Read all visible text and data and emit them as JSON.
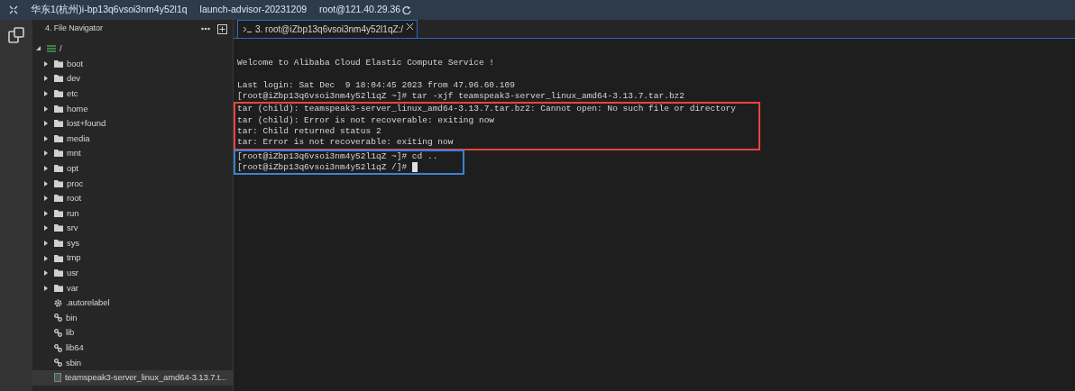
{
  "title_bar": {
    "items": [
      "华东1(杭州)i-bp13q6vsoi3nm4y52l1q",
      "launch-advisor-20231209",
      "root@121.40.29.36"
    ]
  },
  "file_navigator": {
    "title": "4. File Navigator",
    "tree": [
      {
        "label": "/",
        "kind": "root",
        "expanded": true,
        "selected": false,
        "children": [
          {
            "label": "boot",
            "kind": "folder",
            "expanded": false,
            "selected": false
          },
          {
            "label": "dev",
            "kind": "folder",
            "expanded": false,
            "selected": false
          },
          {
            "label": "etc",
            "kind": "folder",
            "expanded": false,
            "selected": false
          },
          {
            "label": "home",
            "kind": "folder",
            "expanded": false,
            "selected": false
          },
          {
            "label": "lost+found",
            "kind": "folder",
            "expanded": false,
            "selected": false
          },
          {
            "label": "media",
            "kind": "folder",
            "expanded": false,
            "selected": false
          },
          {
            "label": "mnt",
            "kind": "folder",
            "expanded": false,
            "selected": false
          },
          {
            "label": "opt",
            "kind": "folder",
            "expanded": false,
            "selected": false
          },
          {
            "label": "proc",
            "kind": "folder",
            "expanded": false,
            "selected": false
          },
          {
            "label": "root",
            "kind": "folder",
            "expanded": false,
            "selected": false
          },
          {
            "label": "run",
            "kind": "folder",
            "expanded": false,
            "selected": false
          },
          {
            "label": "srv",
            "kind": "folder",
            "expanded": false,
            "selected": false
          },
          {
            "label": "sys",
            "kind": "folder",
            "expanded": false,
            "selected": false
          },
          {
            "label": "tmp",
            "kind": "folder",
            "expanded": false,
            "selected": false
          },
          {
            "label": "usr",
            "kind": "folder",
            "expanded": false,
            "selected": false
          },
          {
            "label": "var",
            "kind": "folder",
            "expanded": false,
            "selected": false
          },
          {
            "label": ".autorelabel",
            "kind": "config",
            "selected": false
          },
          {
            "label": "bin",
            "kind": "link",
            "selected": false
          },
          {
            "label": "lib",
            "kind": "link",
            "selected": false
          },
          {
            "label": "lib64",
            "kind": "link",
            "selected": false
          },
          {
            "label": "sbin",
            "kind": "link",
            "selected": false
          },
          {
            "label": "teamspeak3-server_linux_amd64-3.13.7.t...",
            "kind": "file",
            "selected": true
          }
        ]
      }
    ]
  },
  "terminal": {
    "tab": {
      "label": "3. root@iZbp13q6vsoi3nm4y52l1qZ:/",
      "selected": true
    },
    "blocks": [
      {
        "kind": "plain",
        "lines": [
          "Welcome to Alibaba Cloud Elastic Compute Service !"
        ]
      },
      {
        "kind": "plain",
        "lines": [
          "Last login: Sat Dec  9 18:04:45 2023 from 47.96.60.109",
          "[root@iZbp13q6vsoi3nm4y52l1qZ ~]# tar -xjf teamspeak3-server_linux_amd64-3.13.7.tar.bz2"
        ]
      },
      {
        "kind": "highlight",
        "color": "#e8453c",
        "lines": [
          "tar (child): teamspeak3-server_linux_amd64-3.13.7.tar.bz2: Cannot open: No such file or directory",
          "tar (child): Error is not recoverable: exiting now",
          "tar: Child returned status 2",
          "tar: Error is not recoverable: exiting now"
        ]
      },
      {
        "kind": "highlight",
        "color": "#3b82d6",
        "lines": [
          "[root@iZbp13q6vsoi3nm4y52l1qZ ~]# cd ..",
          "[root@iZbp13q6vsoi3nm4y52l1qZ /]# "
        ],
        "cursor": true
      }
    ]
  }
}
